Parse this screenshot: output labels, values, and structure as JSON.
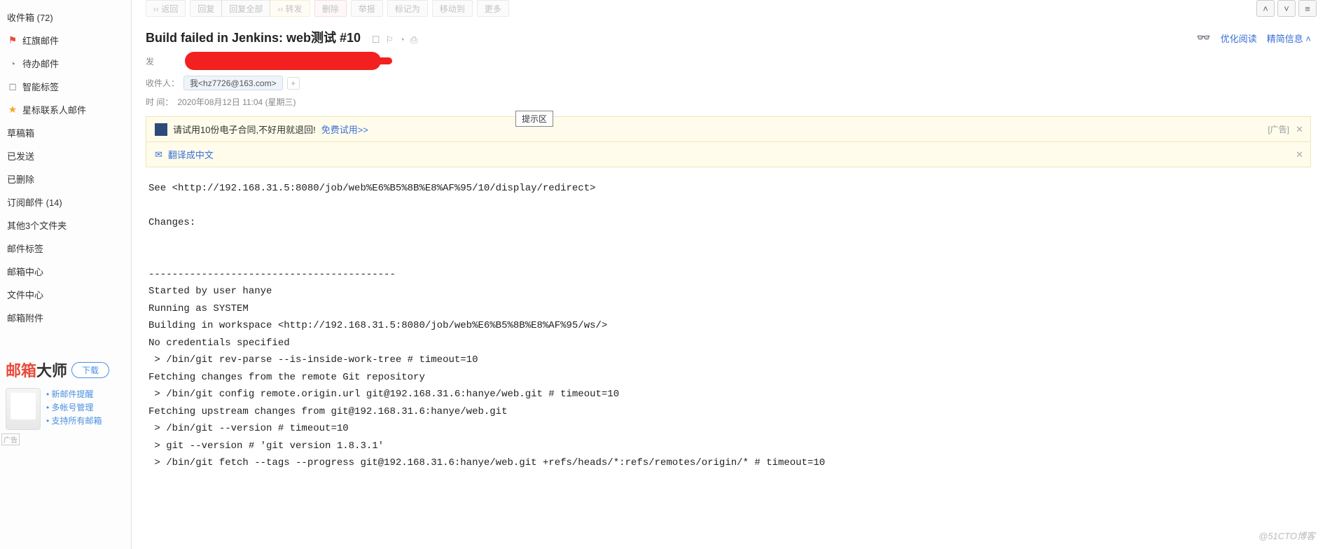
{
  "sidebar": {
    "inbox": "收件箱 (72)",
    "redflag": "红旗邮件",
    "todo": "待办邮件",
    "smarttag": "智能标签",
    "starred": "星标联系人邮件",
    "drafts": "草稿箱",
    "sent": "已发送",
    "deleted": "已删除",
    "subscribe": "订阅邮件 (14)",
    "other3": "其他3个文件夹",
    "tags": "邮件标签",
    "center": "邮箱中心",
    "filecenter": "文件中心",
    "attach": "邮箱附件"
  },
  "promo": {
    "brand_red": "邮箱",
    "brand_black": "大师",
    "download": "下载",
    "f1": "新邮件提醒",
    "f2": "多帐号管理",
    "f3": "支持所有邮箱",
    "ad_tag": "广告"
  },
  "toolbar": {
    "back": "‹‹ 返回",
    "reply": "回复",
    "replyall": "回复全部",
    "forward": "›› 转发",
    "delete": "删除",
    "spam": "举报",
    "mark": "标记为",
    "moveto": "移动到",
    "more": "更多"
  },
  "header": {
    "subject": "Build failed in Jenkins: web测试 #10",
    "optimize": "优化阅读",
    "simplify": "精简信息",
    "sender_label": "发",
    "recipient_label": "收件人：",
    "recipient_chip": "我<hz7726@163.com>",
    "time_label": "时   间：",
    "time_value": "2020年08月12日 11:04 (星期三)"
  },
  "banner": {
    "text": "请试用10份电子合同,不好用就退回!",
    "link": "免费试用>>",
    "ad": "[广告]"
  },
  "translate": {
    "text": "翻译成中文"
  },
  "hint": "提示区",
  "body": "See <http://192.168.31.5:8080/job/web%E6%B5%8B%E8%AF%95/10/display/redirect>\n\nChanges:\n\n\n------------------------------------------\nStarted by user hanye\nRunning as SYSTEM\nBuilding in workspace <http://192.168.31.5:8080/job/web%E6%B5%8B%E8%AF%95/ws/>\nNo credentials specified\n > /bin/git rev-parse --is-inside-work-tree # timeout=10\nFetching changes from the remote Git repository\n > /bin/git config remote.origin.url git@192.168.31.6:hanye/web.git # timeout=10\nFetching upstream changes from git@192.168.31.6:hanye/web.git\n > /bin/git --version # timeout=10\n > git --version # 'git version 1.8.3.1'\n > /bin/git fetch --tags --progress git@192.168.31.6:hanye/web.git +refs/heads/*:refs/remotes/origin/* # timeout=10",
  "watermark": "@51CTO博客"
}
